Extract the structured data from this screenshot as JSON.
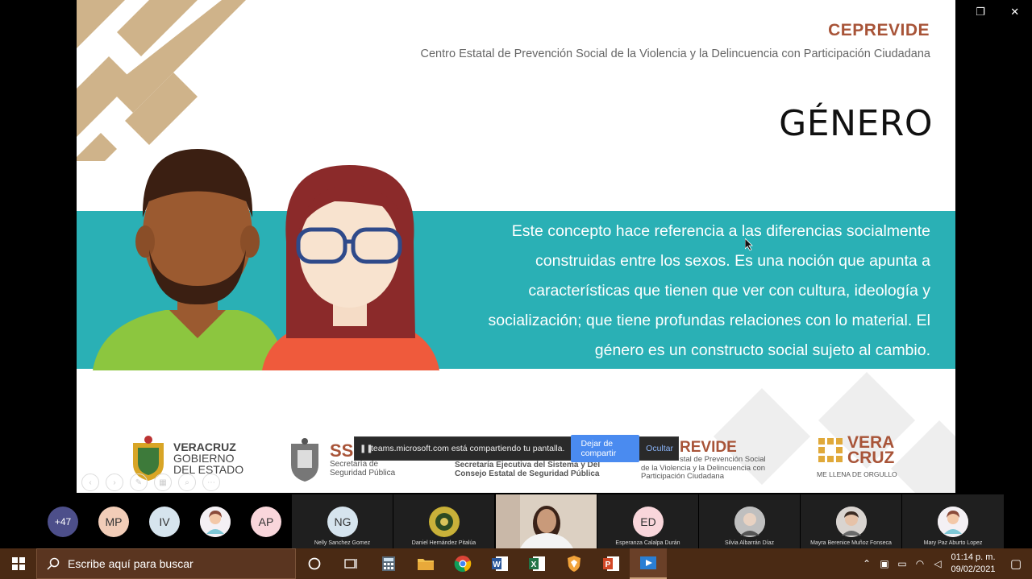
{
  "window": {
    "minimize_glyph": "—",
    "restore_glyph": "❐",
    "close_glyph": "✕"
  },
  "slide": {
    "org_title": "CEPREVIDE",
    "org_subtitle": "Centro Estatal de Prevención Social de la Violencia y la Delincuencia con Participación Ciudadana",
    "heading": "GÉNERO",
    "definition_lines": [
      "Este concepto hace referencia a las diferencias socialmente",
      "construidas entre los sexos. Es una noción que apunta a",
      "características que tienen que ver con cultura, ideología y",
      "socialización; que tiene profundas relaciones con lo material. El",
      "género es un constructo social sujeto al cambio."
    ],
    "logos": {
      "veracruz_gob": [
        "VERACRUZ",
        "GOBIERNO",
        "DEL ESTADO"
      ],
      "ssp_big": "SS",
      "ssp_lines": [
        "Secretaría de",
        "Seguridad Pública"
      ],
      "sesp_lines": [
        "Secretaría Ejecutiva del Sistema y Del",
        "Consejo Estatal de Seguridad Pública"
      ],
      "ceprevide_big": "REVIDE",
      "ceprevide_lines": [
        "stal de Prevención Social",
        "de la Violencia y la Delincuencia con",
        "Participación Ciudadana"
      ],
      "veracruz_big_1": "VERA",
      "veracruz_big_2": "CRUZ",
      "veracruz_tag": "ME LLENA DE ORGULLO"
    }
  },
  "share_bar": {
    "message": "teams.microsoft.com está compartiendo tu pantalla.",
    "stop_label": "Dejar de compartir",
    "hide_label": "Ocultar"
  },
  "participants": {
    "overflow": "+47",
    "initials": [
      "MP",
      "IV",
      "AP"
    ],
    "tiles": [
      {
        "initials": "NG",
        "name": "Nelly Sanchez Gomez"
      },
      {
        "initials": "",
        "name": "Daniel Hernández Pitalúa"
      },
      {
        "initials": "ED",
        "name": "Esperanza Calalpa Durán"
      },
      {
        "initials": "",
        "name": "Silvia Albarrán Díaz"
      },
      {
        "initials": "",
        "name": "Mayra Berenice Muñoz Fonseca"
      },
      {
        "initials": "",
        "name": "Mary Paz Aburto Lopez"
      }
    ]
  },
  "taskbar": {
    "search_placeholder": "Escribe aquí para buscar",
    "time": "01:14 p. m.",
    "date": "09/02/2021"
  },
  "colors": {
    "teal": "#2ab0b5",
    "brand_brown": "#a85438",
    "taskbar": "#4a2a14"
  }
}
